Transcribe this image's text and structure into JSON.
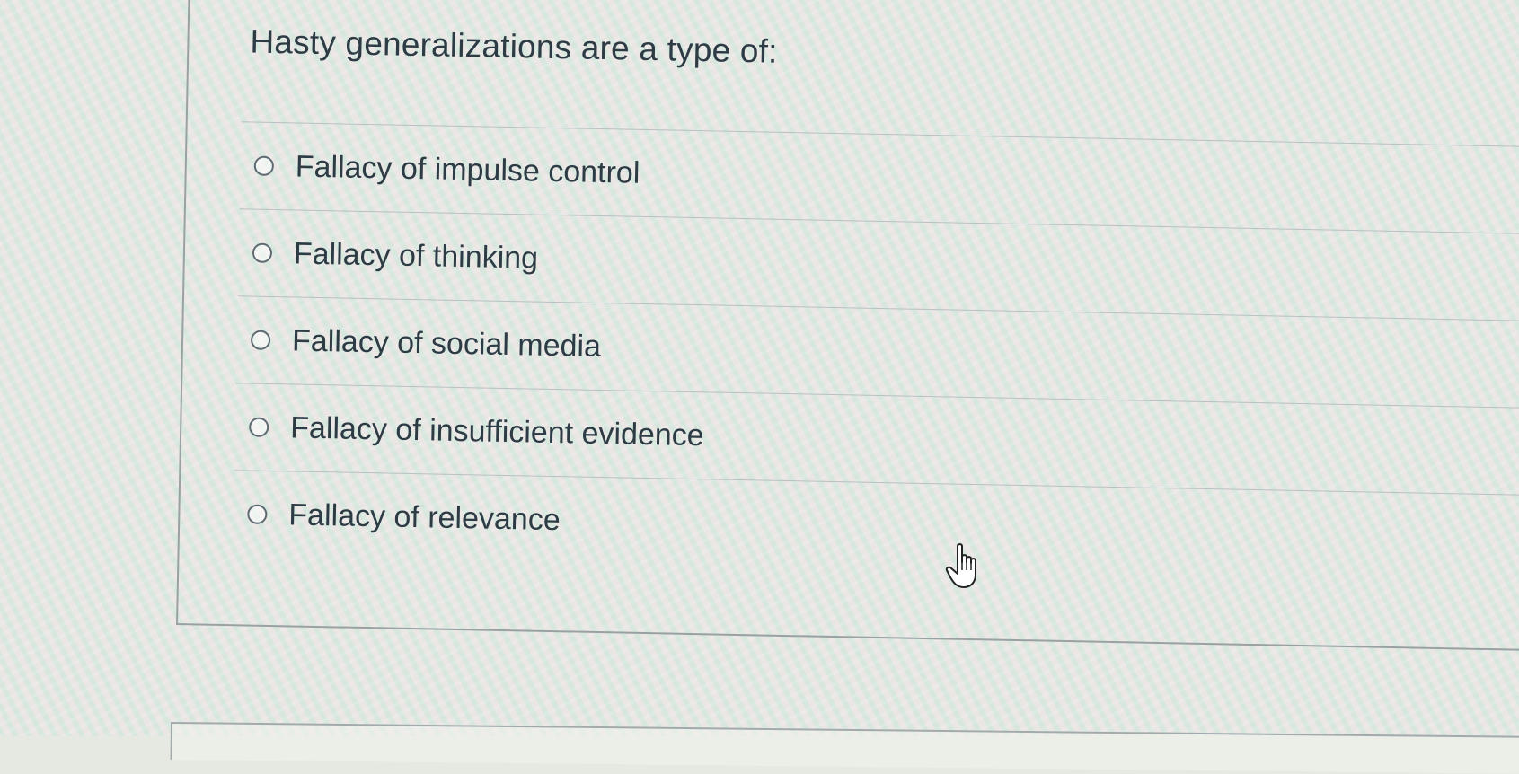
{
  "question": {
    "text": "Hasty generalizations are a type of:"
  },
  "answers": [
    {
      "label": "Fallacy of impulse control",
      "selected": false
    },
    {
      "label": "Fallacy of thinking",
      "selected": false
    },
    {
      "label": "Fallacy of social media",
      "selected": false
    },
    {
      "label": "Fallacy of insufficient evidence",
      "selected": false
    },
    {
      "label": "Fallacy of relevance",
      "selected": false
    }
  ],
  "cursor": {
    "icon": "hand-pointer-icon"
  },
  "colors": {
    "text": "#2d3b45",
    "border": "#9aa1a3",
    "radio_border": "#5d6a72"
  }
}
